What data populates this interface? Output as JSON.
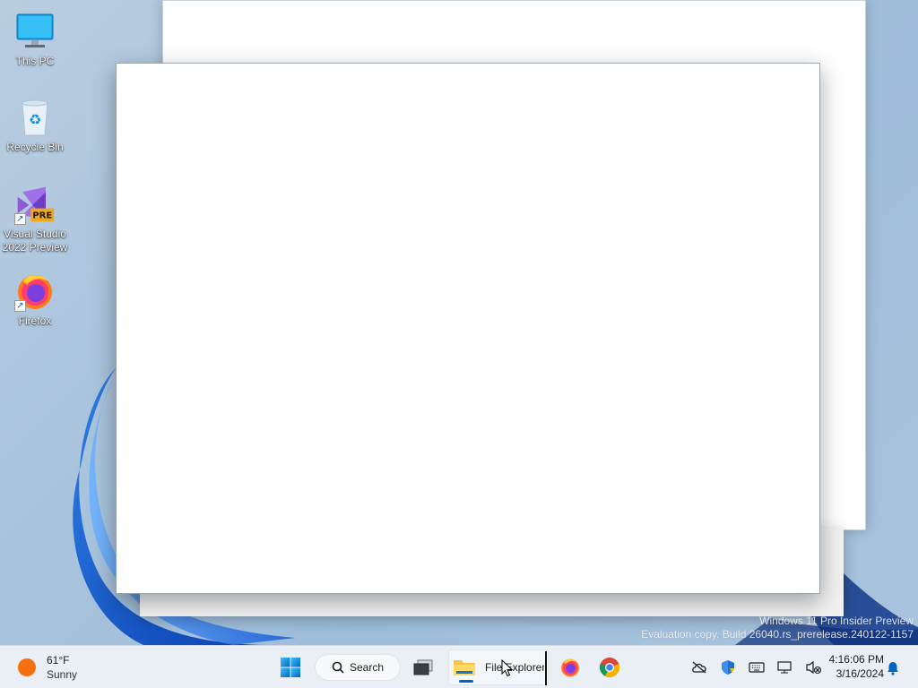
{
  "desktop": {
    "icons": [
      {
        "label": "This PC",
        "icon": "monitor-icon"
      },
      {
        "label": "Recycle Bin",
        "icon": "recycle-bin-icon"
      },
      {
        "label": "Visual Studio 2022 Preview",
        "icon": "visual-studio-preview-icon",
        "badge": "PRE"
      },
      {
        "label": "Firefox",
        "icon": "firefox-icon"
      }
    ]
  },
  "watermark": {
    "line1": "Windows 11 Pro Insider Preview",
    "line2": "Evaluation copy. Build 26040.rs_prerelease.240122-1157"
  },
  "taskbar": {
    "weather": {
      "temp": "61°F",
      "condition": "Sunny",
      "icon": "sun-icon",
      "color": "#f5700f"
    },
    "search_label": "Search",
    "explorer_label": "File Explorer",
    "accent": "#0067c0",
    "clock": {
      "time": "4:16:06 PM",
      "date": "3/16/2024"
    },
    "tray_icons": [
      "onedrive-icon",
      "security-shield-icon",
      "keyboard-icon",
      "network-icon",
      "volume-icon"
    ]
  }
}
